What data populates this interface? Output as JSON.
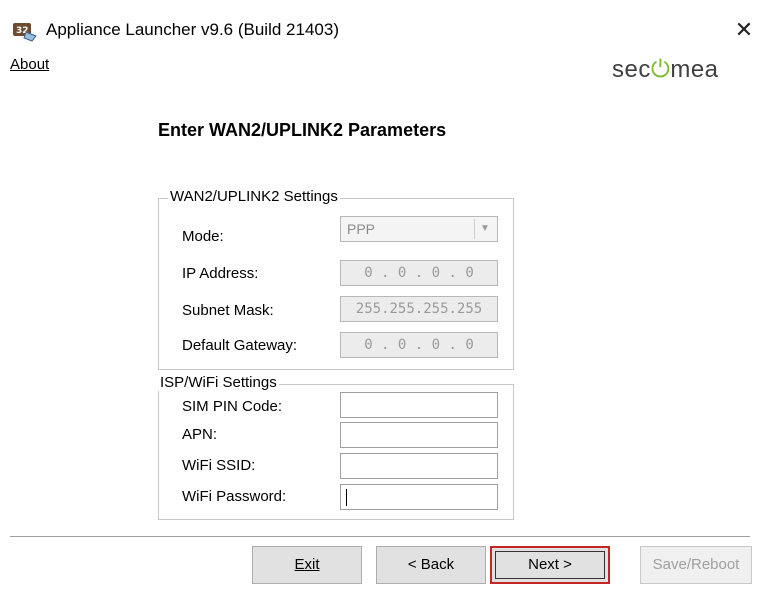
{
  "window": {
    "title": "Appliance Launcher v9.6 (Build 21403)",
    "close_glyph": "✕",
    "icon": "appliance-launcher-icon"
  },
  "menu": {
    "about": "About"
  },
  "brand": {
    "logo_pre": "sec",
    "logo_mark": "⏻",
    "logo_post": "mea",
    "accent": "#7bbd2a"
  },
  "page": {
    "heading": "Enter WAN2/UPLINK2 Parameters"
  },
  "wan_settings": {
    "legend": "WAN2/UPLINK2 Settings",
    "mode_label": "Mode:",
    "mode_value": "PPP",
    "ip_label": "IP Address:",
    "ip_value": "0 . 0 . 0 . 0",
    "subnet_label": "Subnet Mask:",
    "subnet_value": "255.255.255.255",
    "gateway_label": "Default Gateway:",
    "gateway_value": "0 . 0 . 0 . 0"
  },
  "isp_settings": {
    "legend": "ISP/WiFi Settings",
    "sim_pin_label": "SIM PIN Code:",
    "sim_pin_value": "",
    "apn_label": "APN:",
    "apn_value": "",
    "ssid_label": "WiFi SSID:",
    "ssid_value": "",
    "password_label": "WiFi Password:",
    "password_value": ""
  },
  "buttons": {
    "exit": "Exit",
    "back": "< Back",
    "next": "Next >",
    "save_reboot": "Save/Reboot",
    "highlight_color": "#c42525"
  }
}
